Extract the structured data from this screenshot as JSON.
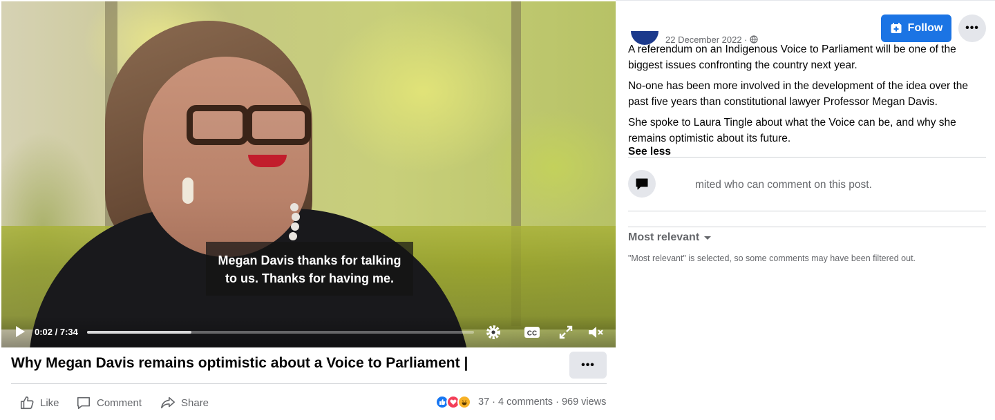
{
  "video": {
    "subtitle_line1": "Megan Davis thanks for talking",
    "subtitle_line2": "to us. Thanks for having me.",
    "time": "0:02 / 7:34",
    "progress_fraction": 0.27
  },
  "post": {
    "title": "Why Megan Davis remains optimistic about a Voice to Parliament |",
    "date": "22 December 2022 ·",
    "paragraphs": [
      "A referendum on an Indigenous Voice to Parliament will be one of the biggest issues confronting the country next year.",
      "No-one has been more involved in the development of the idea over the past five years than constitutional lawyer Professor Megan Davis.",
      "She spoke to Laura Tingle about what the Voice can be, and why she remains optimistic about its future."
    ],
    "see_less": "See less"
  },
  "header": {
    "follow_label": "Follow",
    "more_label": "•••"
  },
  "actions": {
    "like": "Like",
    "comment": "Comment",
    "share": "Share"
  },
  "stats": {
    "reaction_count": "37",
    "comments": "4 comments",
    "views": "969 views",
    "separator": "·"
  },
  "comments": {
    "limited_notice": "mited who can comment on this post.",
    "sort_label": "Most relevant",
    "sort_note": "\"Most relevant\" is selected, so some comments may have been filtered out."
  },
  "colors": {
    "accent": "#1b74e4",
    "like_blue": "#1877f2",
    "love_red": "#f33e58",
    "haha_yellow": "#f7b125"
  }
}
